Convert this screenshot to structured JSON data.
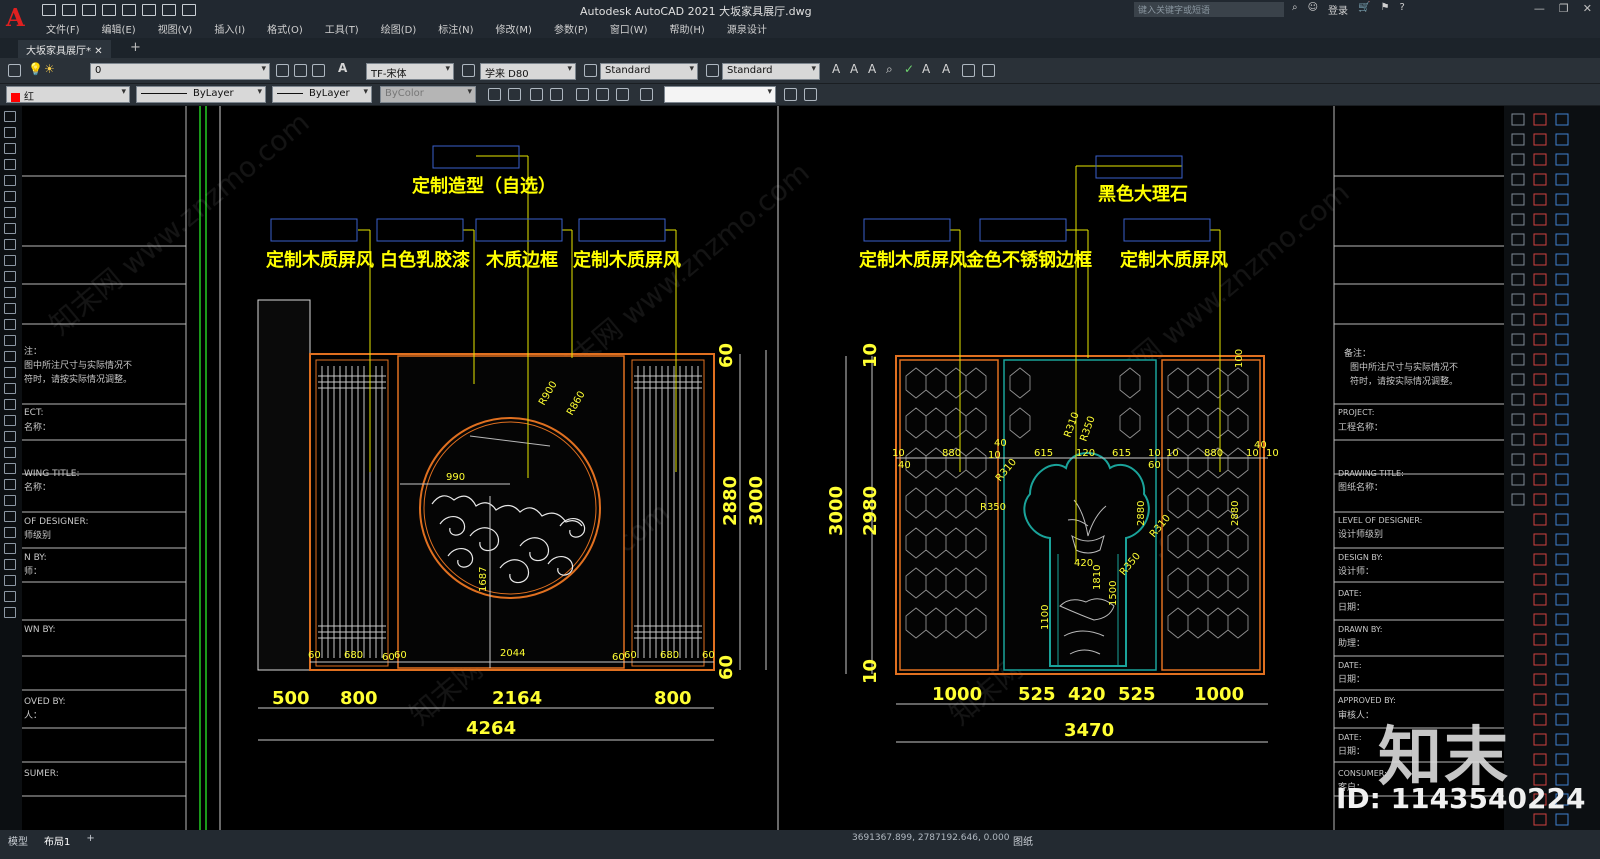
{
  "window": {
    "title": "Autodesk AutoCAD 2021    大坂家具展厅.dwg",
    "search_placeholder": "键入关键字或短语",
    "login": "登录"
  },
  "menu": [
    "文件(F)",
    "编辑(E)",
    "视图(V)",
    "插入(I)",
    "格式(O)",
    "工具(T)",
    "绘图(D)",
    "标注(N)",
    "修改(M)",
    "参数(P)",
    "窗口(W)",
    "帮助(H)",
    "源泉设计"
  ],
  "doc_tab": "大坂家具展厅*",
  "toolbar1": {
    "layer": "0",
    "text_style": "TF-宋体",
    "dim_style": "学来 D80",
    "table_style": "Standard",
    "multileader_style": "Standard"
  },
  "toolbar2": {
    "color": "红",
    "linetype": "ByLayer",
    "lineweight": "ByLayer",
    "plotstyle": "ByColor"
  },
  "left_titleblock": [
    "注：",
    "图中所注尺寸与实际情况不",
    "符时，请按实际情况调整。",
    "ECT:",
    "名称：",
    "WING TITLE:",
    "名称：",
    "OF DESIGNER:",
    "师级别",
    "N BY:",
    "师：",
    "WN BY:",
    "OVED BY:",
    "人：",
    "SUMER:"
  ],
  "right_titleblock": {
    "note_title": "备注：",
    "note_line1": "图中所注尺寸与实际情况不",
    "note_line2": "符时，请按实际情况调整。",
    "project": "PROJECT:",
    "project_cn": "工程名称：",
    "drawing_title": "DRAWING TITLE:",
    "drawing_title_cn": "图纸名称：",
    "level": "LEVEL OF DESIGNER:",
    "level_cn": "设计师级别",
    "design_by": "DESIGN BY:",
    "design_by_cn": "设计师：",
    "date1": "DATE:",
    "date1_cn": "日期：",
    "drawn_by": "DRAWN BY:",
    "drawn_by_cn": "助理：",
    "date2": "DATE:",
    "date2_cn": "日期：",
    "approved_by": "APPROVED BY:",
    "approved_by_cn": "审核人：",
    "date3": "DATE:",
    "date3_cn": "日期：",
    "consumer": "CONSUMER:",
    "consumer_cn": "客户："
  },
  "left_drawing": {
    "labels": {
      "top": "定制造型（自选）",
      "l1": "定制木质屏风",
      "l2": "白色乳胶漆",
      "l3": "木质边框",
      "l4": "定制木质屏风"
    },
    "dims_bottom": [
      "500",
      "800",
      "2164",
      "800"
    ],
    "dim_total": "4264",
    "dim_inner": [
      "60",
      "680",
      "60",
      "60",
      "2044",
      "60",
      "60",
      "680",
      "60"
    ],
    "dim_right": [
      "60",
      "2880",
      "3000",
      "60"
    ],
    "dim_circle": [
      "990",
      "R900",
      "R860",
      "1687"
    ]
  },
  "right_drawing": {
    "labels": {
      "top": "黑色大理石",
      "l1": "定制木质屏风",
      "l2": "金色不锈钢边框",
      "l3": "定制木质屏风"
    },
    "dims_bottom": [
      "1000",
      "525",
      "420",
      "525",
      "1000"
    ],
    "dim_total": "3470",
    "dim_left": [
      "10",
      "2980",
      "3000",
      "10"
    ],
    "dim_top_row": [
      "10",
      "40",
      "880",
      "40",
      "10",
      "615",
      "120",
      "615",
      "10",
      "60",
      "10",
      "880",
      "10",
      "40",
      "10"
    ],
    "dim_misc": [
      "R310",
      "R350",
      "R310",
      "R350",
      "R350",
      "R310",
      "420",
      "2880",
      "1810",
      "1500",
      "1100",
      "2880",
      "100"
    ]
  },
  "watermark": "知末网 www.znzmo.com",
  "brand": "知末",
  "brand_id": "ID: 1143540224",
  "status": {
    "tabs": [
      "模型",
      "布局1"
    ],
    "coords": "3691367.899, 2787192.646, 0.000",
    "paper": "图纸"
  }
}
